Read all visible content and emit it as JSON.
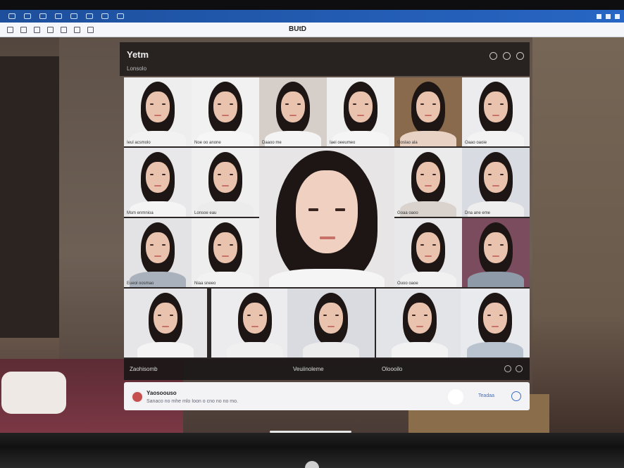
{
  "os": {
    "icons": [
      "finder-icon",
      "mail-icon",
      "messages-icon",
      "photos-icon",
      "cloud-icon",
      "music-icon",
      "settings-icon",
      "chat-icon"
    ]
  },
  "browser": {
    "title": "BUtD"
  },
  "app": {
    "title": "Yetm",
    "subtitle": "Lonsolo",
    "status_left": "Zaohisomb",
    "status_mid": "Veuiinoleme",
    "status_right": "Oloooilo"
  },
  "comment": {
    "name": "Yaosoouso",
    "message": "Sanaco no mhe mlo Ioon o cno no no mo.",
    "send_label": "Teadaa"
  },
  "tiles": [
    {
      "caption": "Ieul acsmolo"
    },
    {
      "caption": "Noe oo anone"
    },
    {
      "caption": "Daaoo me"
    },
    {
      "caption": "Iaei oeeumeo"
    },
    {
      "caption": "Goslao ala"
    },
    {
      "caption": "Oaao oaoie"
    },
    {
      "caption": "Msm enmnioa"
    },
    {
      "caption": "Lonsoe eau"
    },
    {
      "caption": "Goaa oaoo"
    },
    {
      "caption": "Dna ane eme"
    },
    {
      "caption": "Eueol oosmao"
    },
    {
      "caption": "Niaa sneeo"
    },
    {
      "caption": "Ouoo oaoe"
    },
    {
      "caption": ""
    },
    {
      "caption": ""
    },
    {
      "caption": ""
    },
    {
      "caption": ""
    },
    {
      "caption": ""
    }
  ],
  "colors": {
    "accent": "#2766c4",
    "tile_bg": "#eeeeef"
  }
}
